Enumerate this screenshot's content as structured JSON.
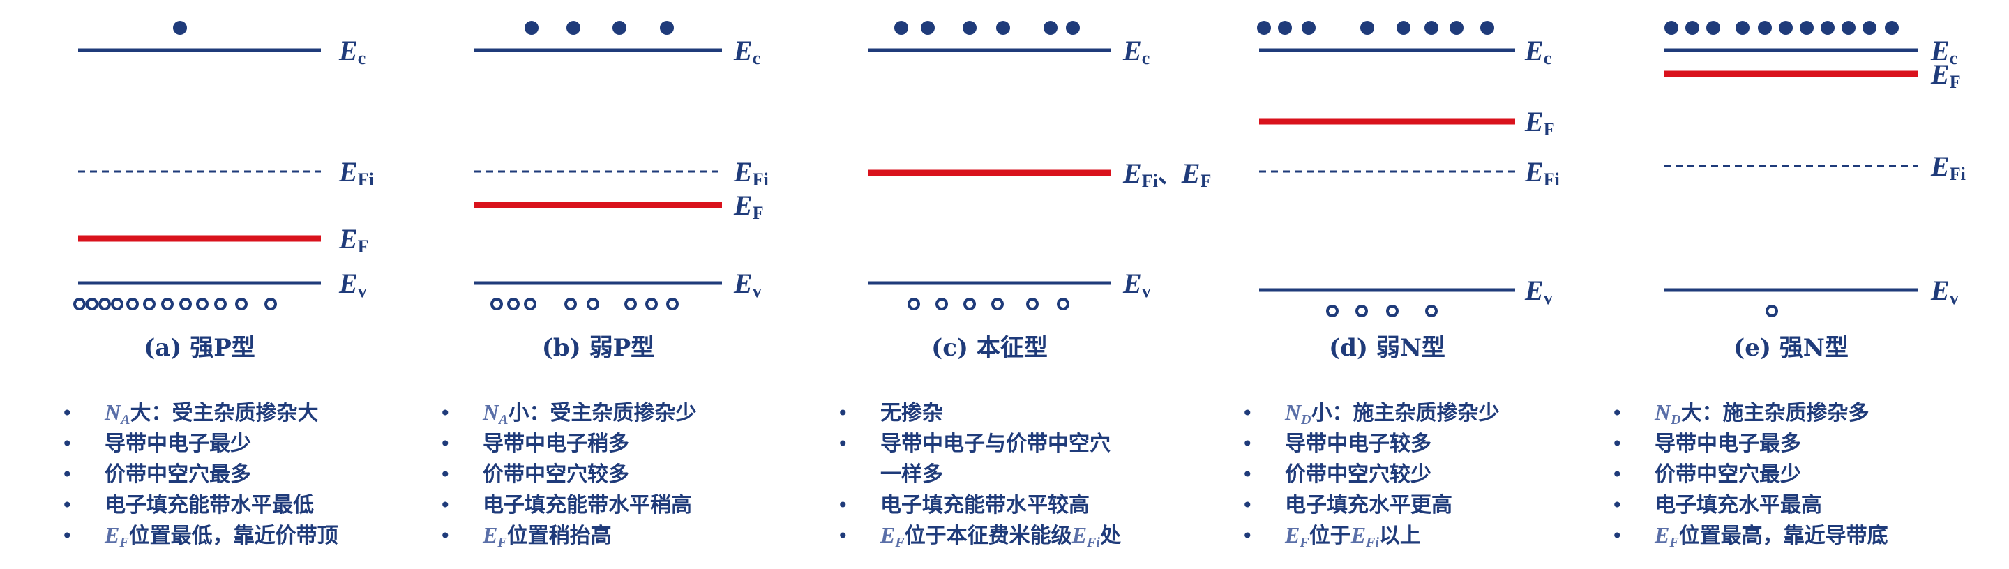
{
  "colors": {
    "band_line": "#1f3b7a",
    "fermi_line": "#d9121c",
    "text": "#1f3b7a",
    "symbol_text": "#5a6fa8"
  },
  "labels": {
    "Ec": {
      "main": "E",
      "sub": "c"
    },
    "Ev": {
      "main": "E",
      "sub": "v"
    },
    "EFi": {
      "main": "E",
      "sub": "Fi"
    },
    "EF": {
      "main": "E",
      "sub": "F"
    },
    "EFi_EF_separator": "、"
  },
  "panels": [
    {
      "caption": "(a) 强P型",
      "electrons": 1,
      "holes": 12,
      "fermi_position": "below_intrinsic_near_valence",
      "bullets": [
        {
          "sym": "N",
          "sub": "A",
          "text": "大：受主杂质掺杂大"
        },
        {
          "text": "导带中电子最少"
        },
        {
          "text": "价带中空穴最多"
        },
        {
          "text": "电子填充能带水平最低"
        },
        {
          "sym": "E",
          "sub": "F",
          "text": "位置最低，靠近价带顶"
        }
      ]
    },
    {
      "caption": "(b) 弱P型",
      "electrons": 4,
      "holes": 8,
      "fermi_position": "slightly_below_intrinsic",
      "bullets": [
        {
          "sym": "N",
          "sub": "A",
          "text": "小：受主杂质掺杂少"
        },
        {
          "text": "导带中电子稍多"
        },
        {
          "text": "价带中空穴较多"
        },
        {
          "text": "电子填充能带水平稍高"
        },
        {
          "sym": "E",
          "sub": "F",
          "text": "位置稍抬高"
        }
      ]
    },
    {
      "caption": "(c) 本征型",
      "electrons": 6,
      "holes": 6,
      "fermi_position": "intrinsic",
      "bullets": [
        {
          "text": "无掺杂"
        },
        {
          "text": "导带中电子与价带中空穴"
        },
        {
          "text": "一样多",
          "continuation": true
        },
        {
          "text": "电子填充能带水平较高"
        },
        {
          "sym": "E",
          "sub": "F",
          "text": "位于本征费米能级",
          "sym2": "E",
          "sub2": "Fi",
          "text2": "处"
        }
      ]
    },
    {
      "caption": "(d) 弱N型",
      "electrons": 8,
      "holes": 4,
      "fermi_position": "above_intrinsic",
      "bullets": [
        {
          "sym": "N",
          "sub": "D",
          "text": "小：施主杂质掺杂少"
        },
        {
          "text": "导带中电子较多"
        },
        {
          "text": "价带中空穴较少"
        },
        {
          "text": "电子填充水平更高"
        },
        {
          "sym": "E",
          "sub": "F",
          "text": "位于",
          "sym2": "E",
          "sub2": "Fi",
          "text2": "以上"
        }
      ]
    },
    {
      "caption": "(e) 强N型",
      "electrons": 11,
      "holes": 1,
      "fermi_position": "near_conduction",
      "bullets": [
        {
          "sym": "N",
          "sub": "D",
          "text": "大：施主杂质掺杂多"
        },
        {
          "text": "导带中电子最多"
        },
        {
          "text": "价带中空穴最少"
        },
        {
          "text": "电子填充水平最高"
        },
        {
          "sym": "E",
          "sub": "F",
          "text": "位置最高，靠近导带底"
        }
      ]
    }
  ]
}
